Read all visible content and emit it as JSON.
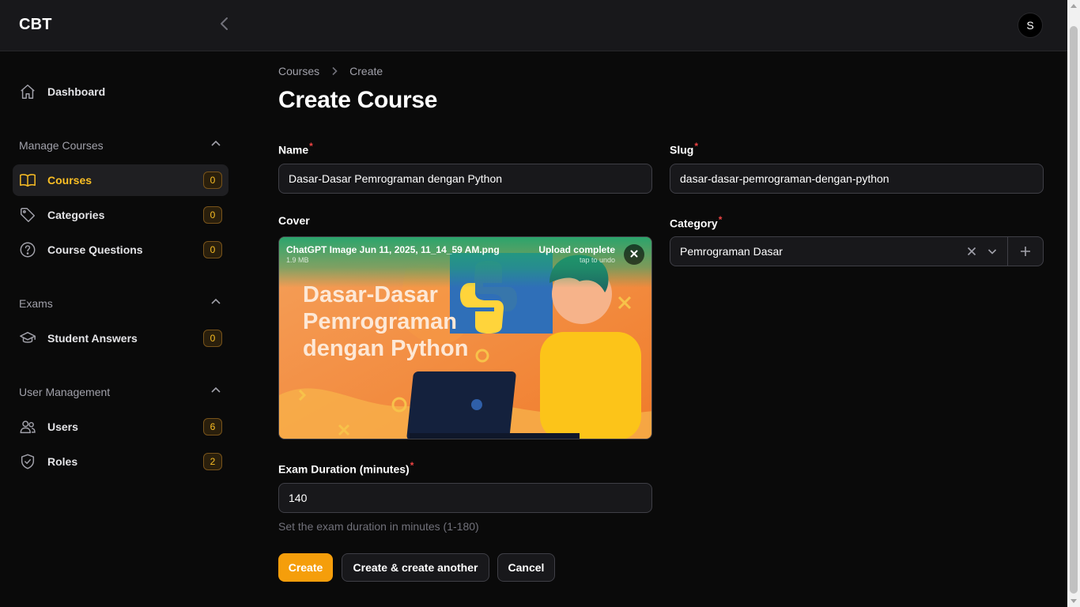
{
  "app": {
    "brand": "CBT",
    "avatar_initial": "S"
  },
  "icons": {
    "collapse": "chevron-left-icon",
    "dashboard": "home-icon",
    "courses": "book-open-icon",
    "categories": "tag-icon",
    "course_questions": "question-circle-icon",
    "student_answers": "academic-cap-icon",
    "users": "users-icon",
    "roles": "shield-check-icon"
  },
  "colors": {
    "accent": "#f59e0b",
    "active_text": "#fbbf24",
    "required": "#ef4444",
    "upload_success": "#20a56e"
  },
  "sidebar": {
    "dashboard": {
      "label": "Dashboard"
    },
    "groups": {
      "manage_courses": {
        "label": "Manage Courses",
        "items": [
          {
            "label": "Courses",
            "badge": "0",
            "active": true
          },
          {
            "label": "Categories",
            "badge": "0"
          },
          {
            "label": "Course Questions",
            "badge": "0"
          }
        ]
      },
      "exams": {
        "label": "Exams",
        "items": [
          {
            "label": "Student Answers",
            "badge": "0"
          }
        ]
      },
      "user_management": {
        "label": "User Management",
        "items": [
          {
            "label": "Users",
            "badge": "6"
          },
          {
            "label": "Roles",
            "badge": "2"
          }
        ]
      }
    }
  },
  "breadcrumb": {
    "parent": "Courses",
    "current": "Create"
  },
  "page": {
    "title": "Create Course"
  },
  "form": {
    "required_marker": "*",
    "name": {
      "label": "Name",
      "value": "Dasar-Dasar Pemrograman dengan Python"
    },
    "slug": {
      "label": "Slug",
      "value": "dasar-dasar-pemrograman-dengan-python"
    },
    "cover": {
      "label": "Cover",
      "file_name": "ChatGPT Image Jun 11, 2025, 11_14_59 AM.png",
      "file_size": "1.9 MB",
      "status": "Upload complete",
      "undo_hint": "tap to undo",
      "image_text": "Dasar-Dasar Pemrograman dengan Python"
    },
    "category": {
      "label": "Category",
      "value": "Pemrograman Dasar"
    },
    "exam_duration": {
      "label": "Exam Duration (minutes)",
      "value": "140",
      "helper": "Set the exam duration in minutes (1-180)"
    }
  },
  "actions": {
    "create": "Create",
    "create_another": "Create & create another",
    "cancel": "Cancel"
  }
}
